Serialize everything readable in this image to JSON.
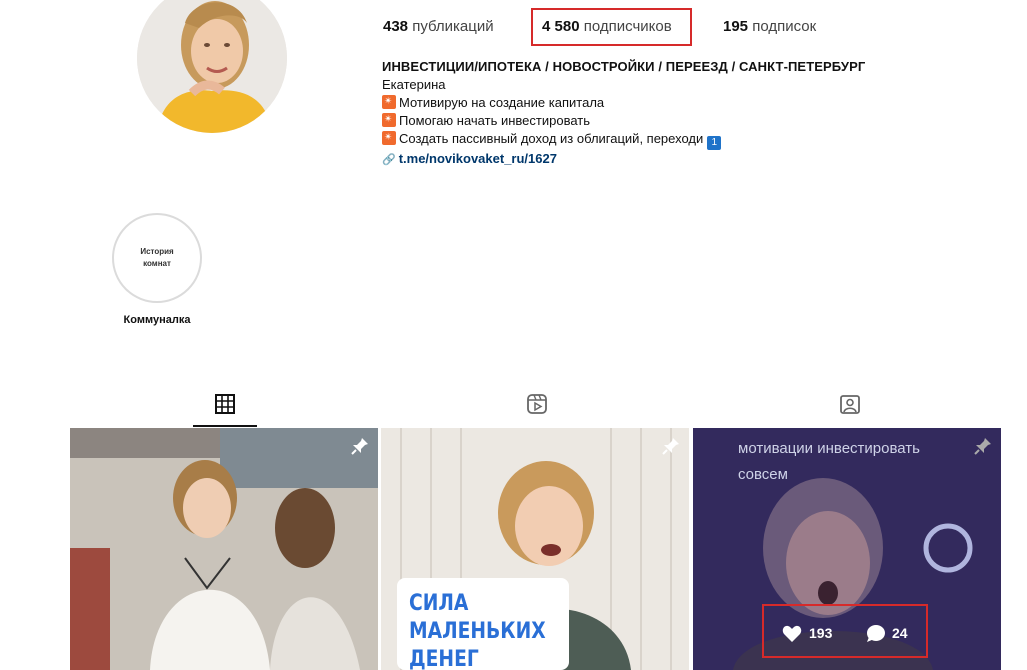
{
  "profile": {
    "stats": {
      "posts_count": "438",
      "posts_label": "публикаций",
      "followers_count": "4 580",
      "followers_label": "подписчиков",
      "following_count": "195",
      "following_label": "подписок"
    },
    "bio": {
      "title": "ИНВЕСТИЦИИ/ИПОТЕКА / НОВОСТРОЙКИ / ПЕРЕЕЗД / САНКТ-ПЕТЕРБУРГ",
      "name": "Екатерина",
      "line1": "Мотивирую на создание капитала",
      "line2": "Помогаю начать инвестировать",
      "line3": "Создать пассивный доход из облигаций, переходи",
      "line3_badge": "1",
      "link": "t.me/novikovaket_ru/1627"
    }
  },
  "highlight": {
    "cover_line1": "История",
    "cover_line2": "комнат",
    "label": "Коммуналка"
  },
  "posts": [
    {
      "overlay_text": "",
      "likes": "",
      "comments": ""
    },
    {
      "overlay_text_lines": [
        "СИЛА",
        "МАЛЕНЬКИХ",
        "ДЕНЕГ"
      ]
    },
    {
      "caption_line1": "мотивации инвестировать",
      "caption_line2": "совсем",
      "likes": "193",
      "comments": "24"
    }
  ],
  "colors": {
    "highlight_box": "#d62a2a",
    "link": "#00376b",
    "post2_text": "#2a6fd6"
  }
}
